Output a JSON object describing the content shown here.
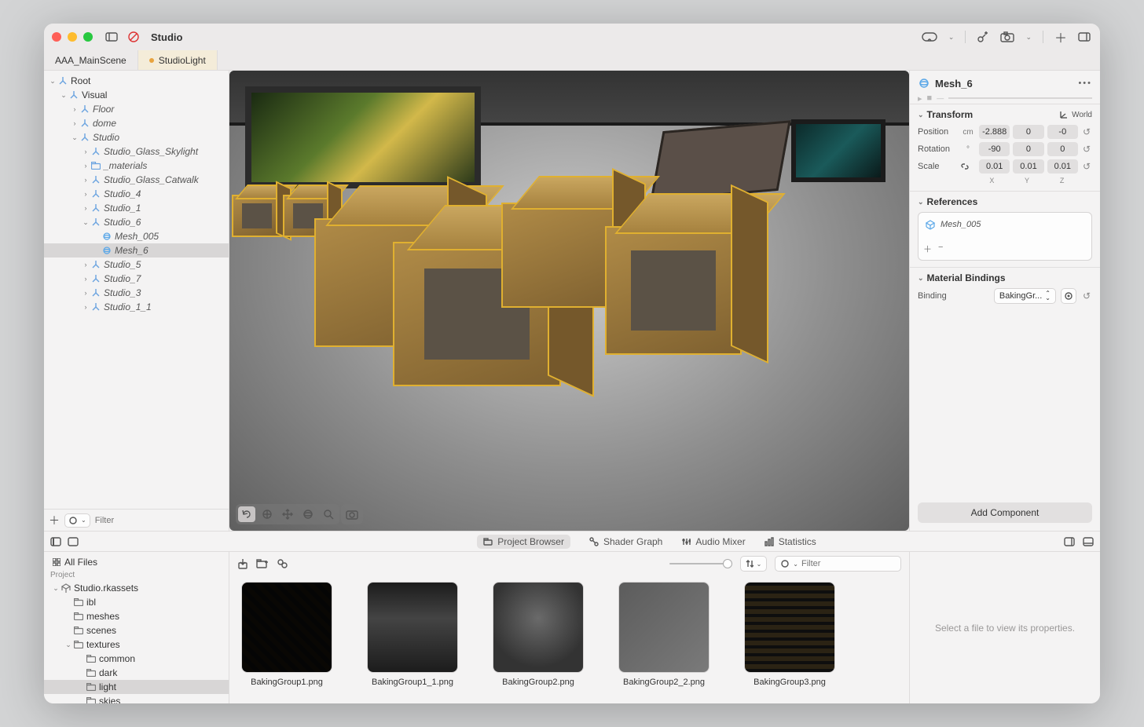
{
  "window": {
    "title": "Studio"
  },
  "tabs": [
    {
      "label": "AAA_MainScene",
      "dirty": false
    },
    {
      "label": "StudioLight",
      "dirty": true,
      "active": true
    }
  ],
  "hierarchy": {
    "filter_placeholder": "Filter",
    "nodes": [
      {
        "depth": 0,
        "label": "Root",
        "open": true,
        "plain": true
      },
      {
        "depth": 1,
        "label": "Visual",
        "open": true,
        "plain": true
      },
      {
        "depth": 2,
        "label": "Floor"
      },
      {
        "depth": 2,
        "label": "dome"
      },
      {
        "depth": 2,
        "label": "Studio",
        "open": true
      },
      {
        "depth": 3,
        "label": "Studio_Glass_Skylight"
      },
      {
        "depth": 3,
        "label": "_materials",
        "folder": true
      },
      {
        "depth": 3,
        "label": "Studio_Glass_Catwalk"
      },
      {
        "depth": 3,
        "label": "Studio_4"
      },
      {
        "depth": 3,
        "label": "Studio_1"
      },
      {
        "depth": 3,
        "label": "Studio_6",
        "open": true
      },
      {
        "depth": 4,
        "label": "Mesh_005",
        "mesh": true
      },
      {
        "depth": 4,
        "label": "Mesh_6",
        "mesh": true,
        "selected": true
      },
      {
        "depth": 3,
        "label": "Studio_5"
      },
      {
        "depth": 3,
        "label": "Studio_7"
      },
      {
        "depth": 3,
        "label": "Studio_3"
      },
      {
        "depth": 3,
        "label": "Studio_1_1"
      }
    ]
  },
  "inspector": {
    "name": "Mesh_6",
    "transform": {
      "title": "Transform",
      "space": "World",
      "position": {
        "label": "Position",
        "unit": "cm",
        "x": "-2.888",
        "y": "0",
        "z": "-0"
      },
      "rotation": {
        "label": "Rotation",
        "unit": "°",
        "x": "-90",
        "y": "0",
        "z": "0"
      },
      "scale": {
        "label": "Scale",
        "unit": "link",
        "x": "0.01",
        "y": "0.01",
        "z": "0.01"
      },
      "axes": [
        "X",
        "Y",
        "Z"
      ]
    },
    "references": {
      "title": "References",
      "items": [
        {
          "label": "Mesh_005"
        }
      ]
    },
    "material": {
      "title": "Material Bindings",
      "binding_label": "Binding",
      "binding_value": "BakingGr..."
    },
    "add_component": "Add Component"
  },
  "bottom": {
    "tabs": [
      {
        "label": "Project Browser",
        "active": true
      },
      {
        "label": "Shader Graph"
      },
      {
        "label": "Audio Mixer"
      },
      {
        "label": "Statistics"
      }
    ],
    "all_files": "All Files",
    "project_heading": "Project",
    "tree": [
      {
        "depth": 0,
        "label": "Studio.rkassets",
        "open": true,
        "pkg": true
      },
      {
        "depth": 1,
        "label": "ibl"
      },
      {
        "depth": 1,
        "label": "meshes"
      },
      {
        "depth": 1,
        "label": "scenes"
      },
      {
        "depth": 1,
        "label": "textures",
        "open": true
      },
      {
        "depth": 2,
        "label": "common"
      },
      {
        "depth": 2,
        "label": "dark"
      },
      {
        "depth": 2,
        "label": "light",
        "selected": true
      },
      {
        "depth": 2,
        "label": "skies"
      }
    ],
    "filter_placeholder": "Filter",
    "assets": [
      {
        "name": "BakingGroup1.png",
        "cls": "t1"
      },
      {
        "name": "BakingGroup1_1.png",
        "cls": "t2"
      },
      {
        "name": "BakingGroup2.png",
        "cls": "t3"
      },
      {
        "name": "BakingGroup2_2.png",
        "cls": "t4"
      },
      {
        "name": "BakingGroup3.png",
        "cls": "t5"
      }
    ],
    "detail_empty": "Select a file to view its properties."
  }
}
